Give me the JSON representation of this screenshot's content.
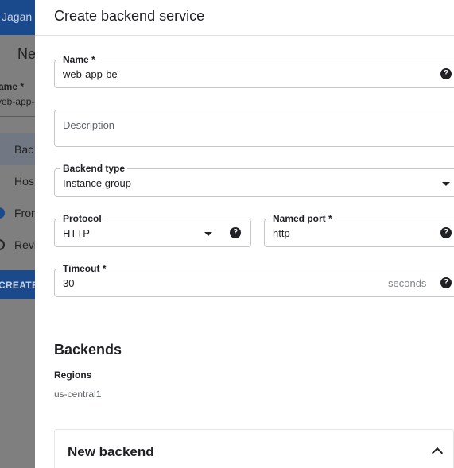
{
  "background": {
    "user_name": "Jagan",
    "page_title": "Ne",
    "name_label": "ame  *",
    "name_value": "veb-app-",
    "nav": [
      "Bac",
      "Hos",
      "Fron",
      "Revi"
    ],
    "create_button": "CREATE"
  },
  "panel": {
    "title": "Create backend service"
  },
  "fields": {
    "name": {
      "label": "Name  *",
      "value": "web-app-be"
    },
    "description": {
      "placeholder": "Description"
    },
    "backend_type": {
      "label": "Backend type",
      "value": "Instance group"
    },
    "protocol": {
      "label": "Protocol",
      "value": "HTTP"
    },
    "named_port": {
      "label": "Named port *",
      "value": "http"
    },
    "timeout": {
      "label": "Timeout *",
      "value": "30",
      "suffix": "seconds"
    }
  },
  "backends": {
    "title": "Backends",
    "regions_label": "Regions",
    "regions_value": "us-central1",
    "new_backend_title": "New backend"
  },
  "icons": {
    "help": "?"
  },
  "colors": {
    "accent": "#1a4a8c",
    "overlay": "#7f7f7f",
    "border": "#c6c6c6"
  }
}
